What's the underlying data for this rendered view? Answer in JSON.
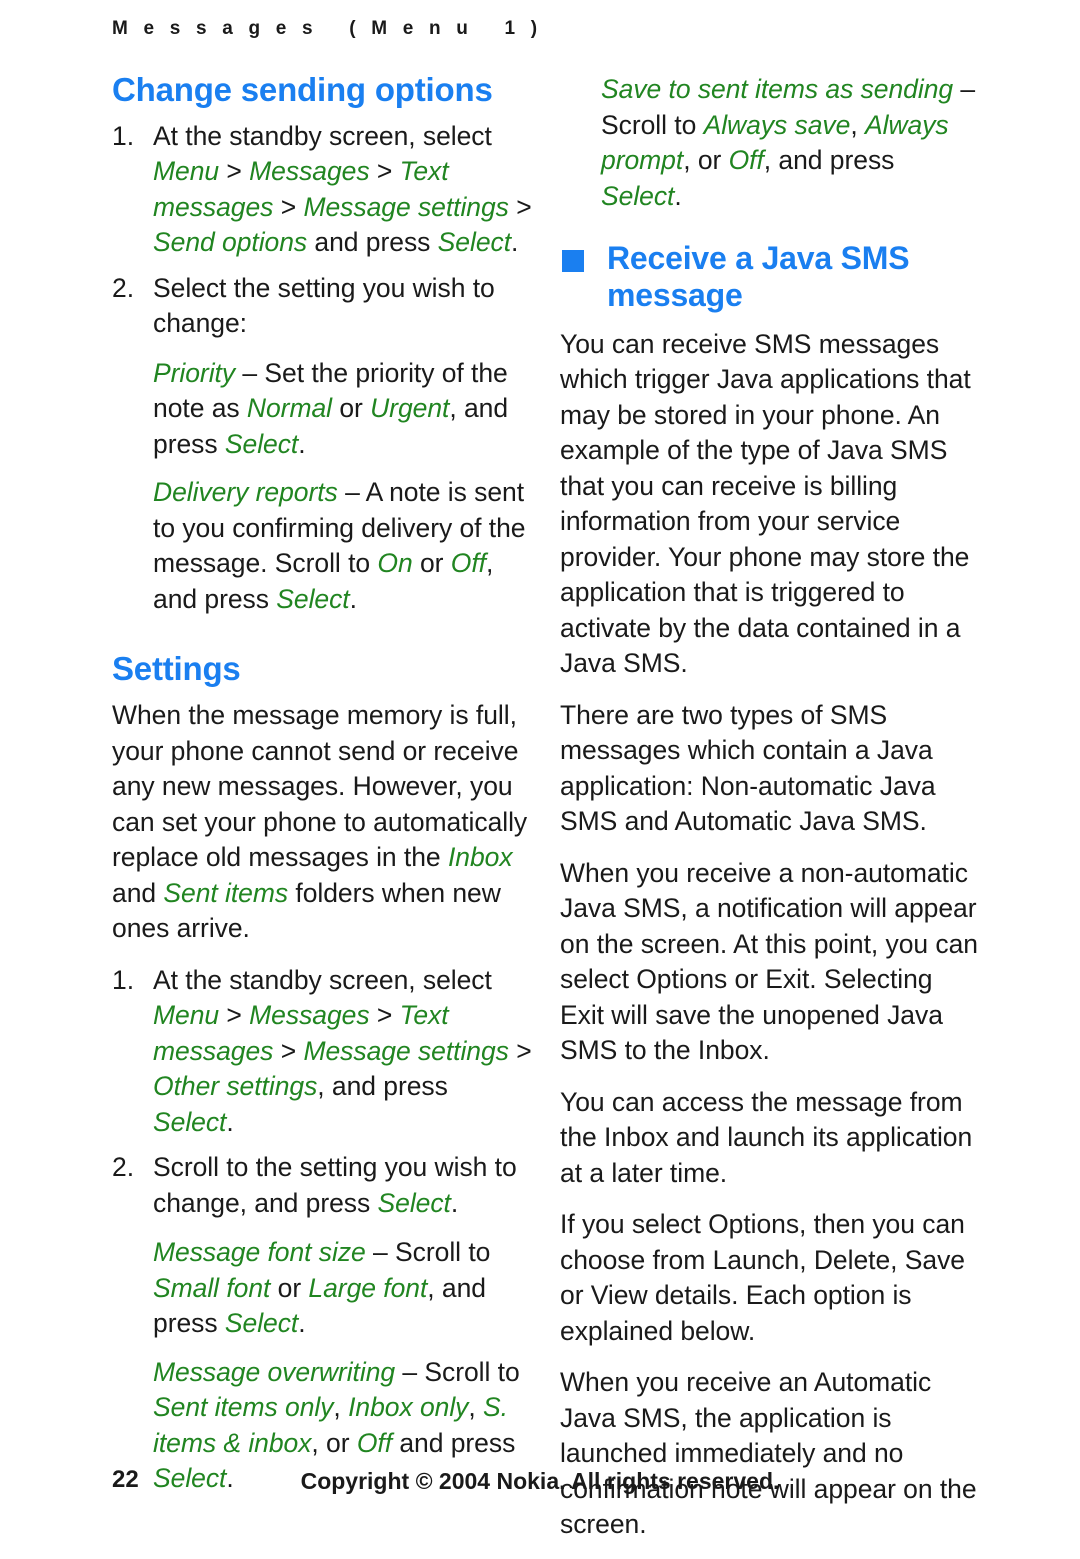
{
  "document": {
    "running_header": "M e s s a g e s   ( M e n u   1 )",
    "accent_blue": "#1a7ff0",
    "ui_term_green": "#218521",
    "text_black": "#1a1a1a"
  },
  "left_column": {
    "heading_change_sending": "Change sending options",
    "step1": {
      "number": "1.",
      "lead": "At the standby screen, select ",
      "term_menu": "Menu",
      "sep1": " > ",
      "term_messages": "Messages",
      "sep2": " > ",
      "term_text_messages": "Text messages",
      "sep3": " > ",
      "term_message_settings": "Message settings",
      "sep4": " > ",
      "term_send_options": "Send options",
      "mid": " and press ",
      "term_select": "Select",
      "end": "."
    },
    "step2": {
      "number": "2.",
      "text": "Select the setting you wish to change:"
    },
    "priority_def": {
      "term": "Priority",
      "dash": " – Set the priority of the note as ",
      "term_normal": "Normal",
      "mid": " or ",
      "term_urgent": "Urgent",
      "mid2": ", and press ",
      "term_select": "Select",
      "end": "."
    },
    "delivery_def": {
      "term": "Delivery reports",
      "dash": " – A note is sent to you confirming delivery of the message. Scroll to ",
      "term_on": "On",
      "mid": " or ",
      "term_off": "Off",
      "mid2": ", and press ",
      "term_select": "Select",
      "end": "."
    },
    "heading_settings": "Settings",
    "settings_intro": {
      "lead": "When the message memory is full, your phone cannot send or receive any new messages. However, you can set your phone to automatically replace old messages in the ",
      "term_inbox": "Inbox",
      "mid": " and ",
      "term_sent_items": "Sent items",
      "end": " folders when new ones arrive."
    },
    "settings_step1": {
      "number": "1.",
      "lead": "At the standby screen, select ",
      "term_menu": "Menu",
      "sep1": " > ",
      "term_messages": "Messages",
      "sep2": " > ",
      "term_text_messages": "Text messages",
      "sep3": " > ",
      "term_message_settings": "Message settings",
      "sep4": " > ",
      "term_other_settings": "Other settings",
      "mid": ", and press ",
      "term_select": "Select",
      "end": "."
    },
    "settings_step2": {
      "number": "2.",
      "lead": "Scroll to the setting you wish to change, and press ",
      "term_select": "Select",
      "end": "."
    },
    "font_size_def": {
      "term": "Message font size",
      "dash": " – Scroll to ",
      "term_small": "Small font",
      "mid": " or ",
      "term_large": "Large font",
      "mid2": ", and press ",
      "term_select": "Select",
      "end": "."
    },
    "overwriting_def": {
      "term": "Message overwriting",
      "dash": " – Scroll to ",
      "term_sent_only": "Sent items only",
      "comma1": ", ",
      "term_inbox_only": "Inbox only",
      "comma2": ", ",
      "term_s_items": "S. items & inbox",
      "mid": ", or ",
      "term_off": "Off",
      "mid2": " and press ",
      "term_select": "Select",
      "end": "."
    }
  },
  "right_column": {
    "save_def": {
      "term": "Save to sent items as sending",
      "dash": " – Scroll to ",
      "term_always_save": "Always save",
      "comma1": ", ",
      "term_always_prompt": "Always prompt",
      "mid": ", or ",
      "term_off": "Off",
      "mid2": ", and press ",
      "term_select": "Select",
      "end": "."
    },
    "heading_receive_java": "Receive a Java SMS message",
    "bullet_icon": "blue-square-bullet-icon",
    "para1": "You can receive SMS messages which trigger Java applications that may be stored in your phone. An example of the type of Java SMS that you can receive is billing information from your service provider. Your phone may store the application that is triggered to activate by the data contained in a Java SMS.",
    "para2": "There are two types of SMS messages which contain a Java application: Non-automatic Java SMS and Automatic Java SMS.",
    "para3": "When you receive a non-automatic Java SMS, a notification will appear on the screen. At this point, you can select Options or Exit. Selecting Exit will save the unopened Java SMS to the Inbox.",
    "para4": "You can access the message from the Inbox and launch its application at a later time.",
    "para5": "If you select Options, then you can choose from Launch, Delete, Save or View details. Each option is explained below.",
    "para6": "When you receive an Automatic Java SMS, the application is launched immediately and no confirmation note will appear on the screen."
  },
  "footer": {
    "page_number": "22",
    "copyright": "Copyright © 2004 Nokia. All rights reserved."
  }
}
